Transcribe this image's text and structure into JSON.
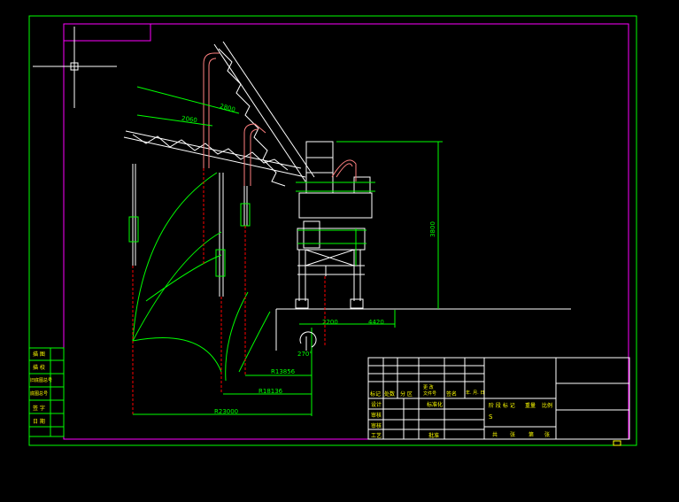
{
  "colors": {
    "background": "#000000",
    "green": "#00ff00",
    "magenta": "#ff00ff",
    "white": "#ffffff",
    "red": "#ff0000",
    "pink": "#ff8080",
    "yellow": "#ffff00"
  },
  "dimensions": {
    "upper_boom": "2800",
    "inner_boom": "2060",
    "column_height": "3800",
    "base_left": "2200",
    "base_right": "4420",
    "radius_1": "R13856",
    "radius_2": "R18136",
    "radius_3": "R23000",
    "rotation_angle": "270°"
  },
  "side_panel": {
    "rows": [
      "描 图",
      "描 校",
      "旧底图总号",
      "底图总号",
      "签 字",
      "日 期"
    ]
  },
  "title_block": {
    "header_cells": [
      "标记",
      "处数",
      "分 区",
      "更 改\n文件号",
      "签名",
      "年. 月. 日"
    ],
    "role_rows": [
      "设计",
      "审核",
      "审核",
      "工艺"
    ],
    "standardize": "标准化",
    "approve": "批准",
    "stage_header": [
      "阶 段 标 记",
      "重量",
      "比例"
    ],
    "stage_mark": "S",
    "sheet_row": [
      "共",
      "张",
      "第",
      "张"
    ]
  }
}
